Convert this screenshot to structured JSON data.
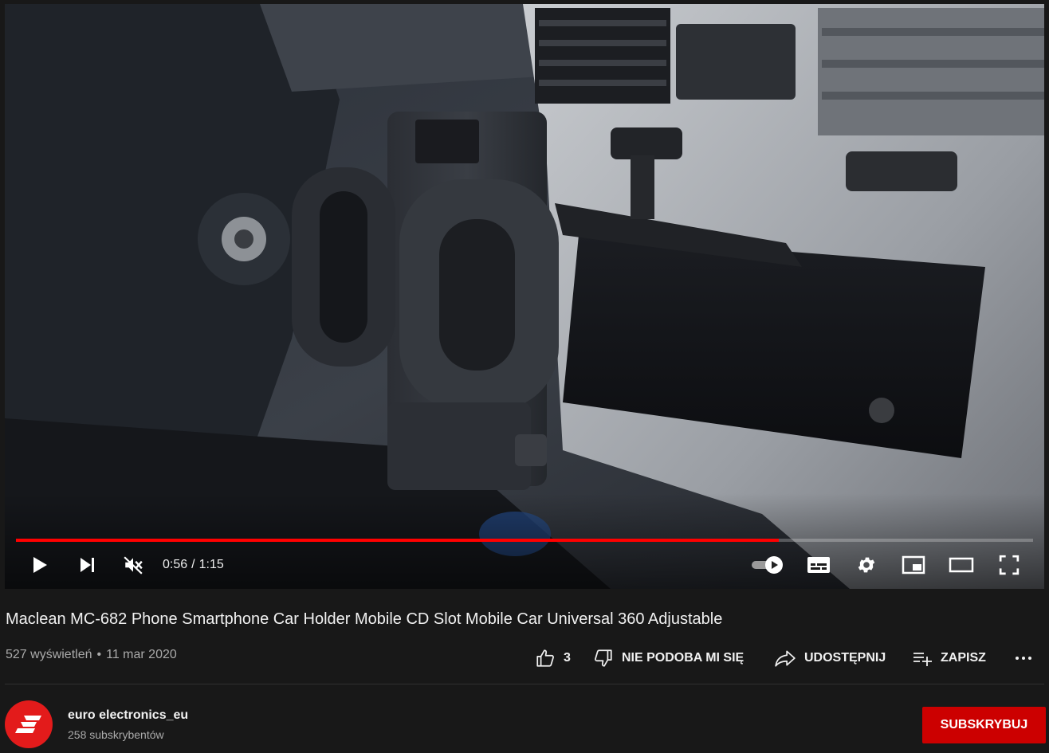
{
  "player": {
    "progress_fraction": 0.75,
    "time_current": "0:56",
    "time_separator": "/",
    "time_total": "1:15",
    "muted": true,
    "autoplay_on": true,
    "controls": {
      "play_icon": "play-icon",
      "next_icon": "skip-next-icon",
      "mute_icon": "volume-muted-icon",
      "autoplay_icon": "autoplay-toggle-icon",
      "subtitles_icon": "subtitles-icon",
      "settings_icon": "gear-icon",
      "miniplayer_icon": "miniplayer-icon",
      "theater_icon": "theater-mode-icon",
      "fullscreen_icon": "fullscreen-icon"
    }
  },
  "video": {
    "title": "Maclean MC-682 Phone Smartphone Car Holder Mobile CD Slot Mobile Car Universal 360 Adjustable",
    "views": "527 wyświetleń",
    "date_separator": "•",
    "date": "11 mar 2020"
  },
  "actions": {
    "like_count": "3",
    "dislike_label": "NIE PODOBA MI SIĘ",
    "share_label": "UDOSTĘPNIJ",
    "save_label": "ZAPISZ",
    "more_icon": "more-horizontal-icon"
  },
  "channel": {
    "name": "euro electronics_eu",
    "subscribers": "258 subskrybentów",
    "subscribe_label": "SUBSKRYBUJ",
    "avatar_color": "#e31b1b"
  },
  "colors": {
    "background": "#181818",
    "progress": "#ff0000",
    "subscribe": "#cc0000",
    "text_primary": "#f1f1f1",
    "text_secondary": "#aaaaaa"
  }
}
